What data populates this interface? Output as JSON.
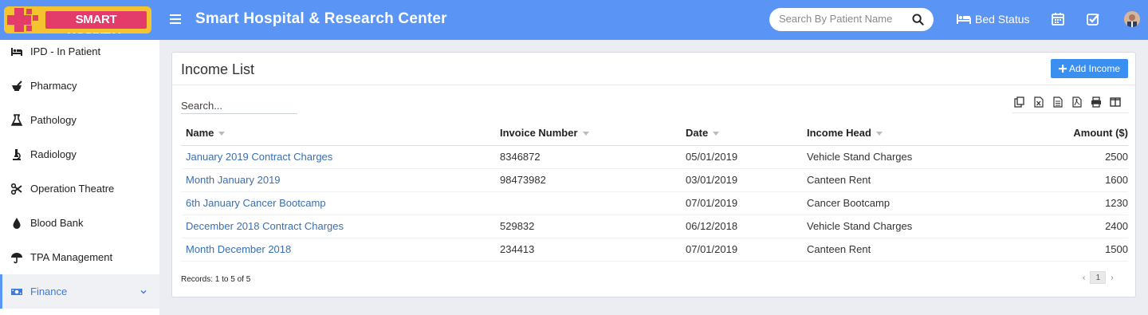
{
  "brand": {
    "logo_text": "SMART HOSPITAL"
  },
  "header": {
    "app_title": "Smart Hospital & Research Center",
    "search_placeholder": "Search By Patient Name",
    "bed_status_label": "Bed Status",
    "icons": [
      "menu-icon",
      "search-icon",
      "bed-icon",
      "calendar-icon",
      "checklist-icon",
      "user-avatar"
    ],
    "accent_color": "#5a95f5"
  },
  "sidebar": {
    "items": [
      {
        "label": "IPD - In Patient",
        "icon": "bed-icon"
      },
      {
        "label": "Pharmacy",
        "icon": "mortar-pestle-icon"
      },
      {
        "label": "Pathology",
        "icon": "flask-icon"
      },
      {
        "label": "Radiology",
        "icon": "microscope-icon"
      },
      {
        "label": "Operation Theatre",
        "icon": "scissors-icon"
      },
      {
        "label": "Blood Bank",
        "icon": "droplet-icon"
      },
      {
        "label": "TPA Management",
        "icon": "umbrella-icon"
      },
      {
        "label": "Finance",
        "icon": "money-icon",
        "active": true,
        "expandable": true
      }
    ]
  },
  "panel": {
    "title": "Income List",
    "add_button_label": "Add Income",
    "search_placeholder": "Search...",
    "export_tools": [
      "copy-icon",
      "excel-icon",
      "csv-icon",
      "pdf-icon",
      "print-icon",
      "columns-icon"
    ],
    "columns": [
      "Name",
      "Invoice Number",
      "Date",
      "Income Head",
      "Amount ($)"
    ],
    "rows": [
      {
        "name": "January 2019 Contract Charges",
        "invoice": "8346872",
        "date": "05/01/2019",
        "head": "Vehicle Stand Charges",
        "amount": "2500"
      },
      {
        "name": "Month January 2019",
        "invoice": "98473982",
        "date": "03/01/2019",
        "head": "Canteen Rent",
        "amount": "1600"
      },
      {
        "name": "6th January Cancer Bootcamp",
        "invoice": "",
        "date": "07/01/2019",
        "head": "Cancer Bootcamp",
        "amount": "1230"
      },
      {
        "name": "December 2018 Contract Charges",
        "invoice": "529832",
        "date": "06/12/2018",
        "head": "Vehicle Stand Charges",
        "amount": "2400"
      },
      {
        "name": "Month December 2018",
        "invoice": "234413",
        "date": "07/01/2019",
        "head": "Canteen Rent",
        "amount": "1500"
      }
    ],
    "records_text": "Records: 1 to 5 of 5",
    "pagination": {
      "prev": "‹",
      "current_page": "1",
      "next": "›"
    }
  }
}
